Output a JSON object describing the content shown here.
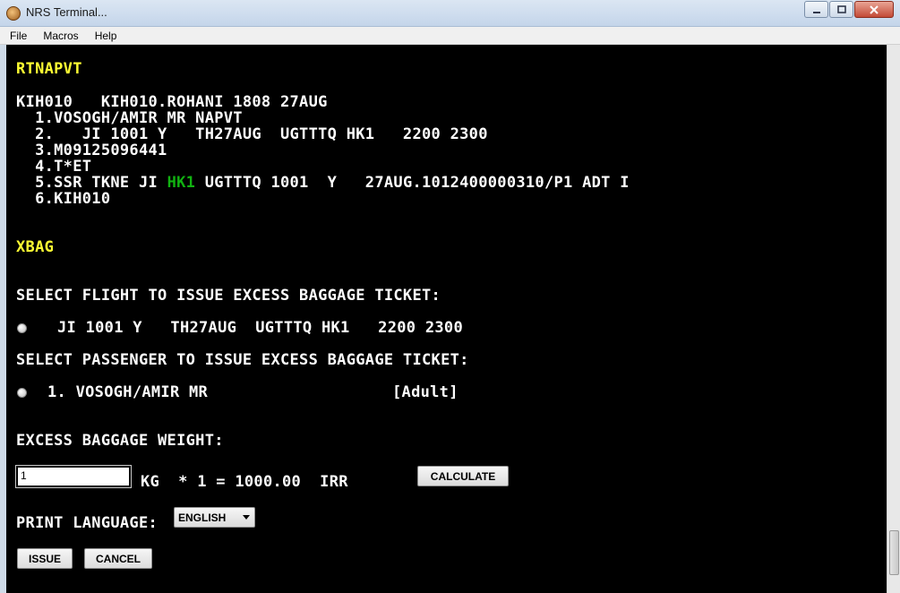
{
  "window": {
    "title": "NRS Terminal..."
  },
  "menu": [
    "File",
    "Macros",
    "Help"
  ],
  "pnr": {
    "command": "RTNAPVT",
    "header": "KIH010   KIH010.ROHANI 1808 27AUG",
    "line1": "  1.VOSOGH/AMIR MR NAPVT",
    "line2": "  2.   JI 1001 Y   TH27AUG  UGTTTQ HK1   2200 2300",
    "line3": "  3.M09125096441",
    "line4": "  4.T*ET",
    "line5_prefix": "  5.SSR TKNE JI ",
    "line5_status": "HK1",
    "line5_suffix": " UGTTTQ 1001  Y   27AUG.1012400000310/P1 ADT I",
    "line6": "  6.KIH010"
  },
  "xbag": {
    "command": "XBAG",
    "select_flight_prompt": "SELECT FLIGHT TO ISSUE EXCESS BAGGAGE TICKET:",
    "flight_option": "JI 1001 Y   TH27AUG  UGTTTQ HK1   2200 2300",
    "select_passenger_prompt": "SELECT PASSENGER TO ISSUE EXCESS BAGGAGE TICKET:",
    "passenger_option": "1. VOSOGH/AMIR MR",
    "passenger_type": "[Adult]",
    "weight_label": "EXCESS BAGGAGE WEIGHT:",
    "weight_value": "1",
    "calc_text": "KG  * 1 = 1000.00  IRR",
    "calculate_label": "CALCULATE",
    "language_label": "PRINT LANGUAGE:",
    "language_selected": "ENGLISH",
    "issue_label": "ISSUE",
    "cancel_label": "CANCEL"
  }
}
